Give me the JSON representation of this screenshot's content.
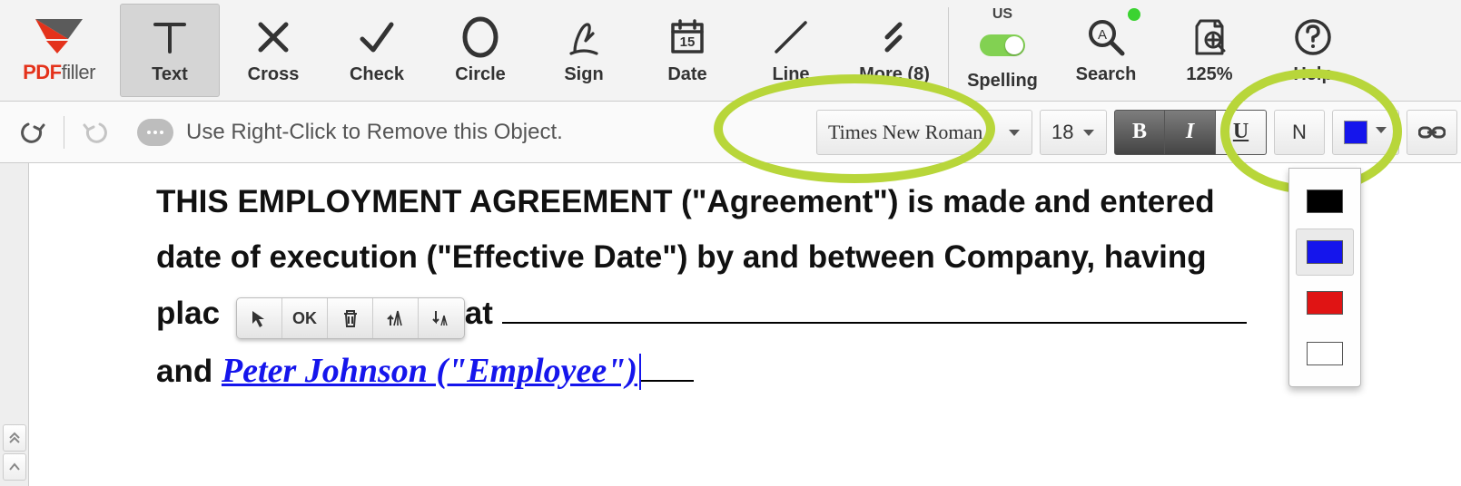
{
  "app": {
    "logo_pdf": "PDF",
    "logo_filler": "filler"
  },
  "toolbar": {
    "text": "Text",
    "cross": "Cross",
    "check": "Check",
    "circle": "Circle",
    "sign": "Sign",
    "date": "Date",
    "date_day": "15",
    "line": "Line",
    "more": "More (8)",
    "spelling": "Spelling",
    "spelling_region": "US",
    "search": "Search",
    "zoom": "125%",
    "help": "Help"
  },
  "format": {
    "hint": "Use Right-Click to Remove this Object.",
    "font_family": "Times New Roman",
    "font_size": "18",
    "bold": "B",
    "italic": "I",
    "underline": "U",
    "normal": "N",
    "current_color": "#1515ec"
  },
  "mini_toolbar": {
    "ok": "OK"
  },
  "color_options": [
    "#000000",
    "#1515ec",
    "#e01414",
    "#ffffff"
  ],
  "document": {
    "line1": "THIS EMPLOYMENT AGREEMENT (\"Agreement\") is made and entered",
    "line2": "date of execution (\"Effective Date\") by and between Company, having",
    "line3a": "plac",
    "line3b": " at ",
    "line4a": "and ",
    "employee": "Peter Johnson (\"Employee\")"
  }
}
